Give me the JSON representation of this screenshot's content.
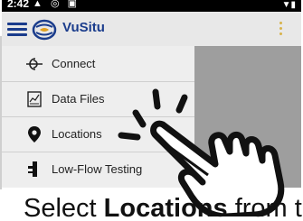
{
  "status_bar": {
    "time": "2:42",
    "icons": "▲ ◎ ▣",
    "right": "▼▮"
  },
  "app_bar": {
    "title": "VuSitu",
    "menu_icon": "hamburger-icon",
    "logo_icon": "vusitu-logo-icon",
    "overflow_icon": "more-vert-icon",
    "accent_color": "#1a3c8c",
    "overflow_color": "#d8b24a"
  },
  "drawer": {
    "items": [
      {
        "label": "Connect",
        "icon": "connect-icon"
      },
      {
        "label": "Data Files",
        "icon": "data-files-icon"
      },
      {
        "label": "Locations",
        "icon": "location-pin-icon"
      },
      {
        "label": "Low-Flow Testing",
        "icon": "low-flow-pump-icon"
      }
    ]
  },
  "caption": {
    "prefix": "Select ",
    "bold": "Locations",
    "suffix": " from the"
  },
  "overlay": {
    "icon": "tapping-hand-icon"
  }
}
